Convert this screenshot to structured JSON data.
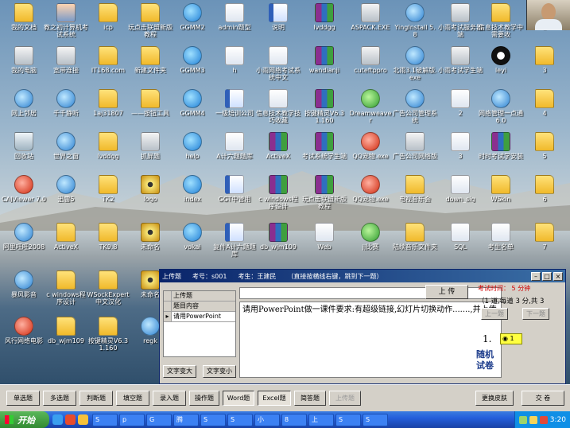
{
  "desktop": {
    "icons": [
      {
        "label": "我的文档",
        "glyph": "g-folder",
        "icon": "my-documents-icon"
      },
      {
        "label": "教之初计算机考试系统",
        "glyph": "g-person",
        "icon": "exam-system-icon"
      },
      {
        "label": "icp",
        "glyph": "g-folder",
        "icon": "folder-icon"
      },
      {
        "label": "玩点击联盟新版教程",
        "glyph": "g-folder",
        "icon": "folder-icon"
      },
      {
        "label": "GGMM2",
        "glyph": "g-ie",
        "icon": "ie-icon"
      },
      {
        "label": "admin题型",
        "glyph": "g-doc",
        "icon": "doc-icon"
      },
      {
        "label": "说明",
        "glyph": "g-word",
        "icon": "word-doc-icon"
      },
      {
        "label": "lvddgg",
        "glyph": "g-rar",
        "icon": "rar-icon"
      },
      {
        "label": "ASPACK.EXE",
        "glyph": "g-exe",
        "icon": "exe-icon"
      },
      {
        "label": "YingInstall 5.8",
        "glyph": "g-blue",
        "icon": "installer-icon"
      },
      {
        "label": "小雨考试服务器端",
        "glyph": "g-exe",
        "icon": "server-icon"
      },
      {
        "label": "信息技术教学中需要收",
        "glyph": "g-folder",
        "icon": "folder-icon"
      },
      {
        "label": "2",
        "glyph": "g-folder",
        "icon": "folder-icon"
      },
      {
        "label": "我的电脑",
        "glyph": "g-exe",
        "icon": "my-computer-icon"
      },
      {
        "label": "宽带连接",
        "glyph": "g-exe",
        "icon": "broadband-icon"
      },
      {
        "label": "IT168.com",
        "glyph": "g-folder",
        "icon": "folder-icon"
      },
      {
        "label": "新建文件夹",
        "glyph": "g-folder",
        "icon": "folder-icon"
      },
      {
        "label": "GGMM3",
        "glyph": "g-ie",
        "icon": "ie-icon"
      },
      {
        "label": "h",
        "glyph": "g-doc",
        "icon": "doc-icon"
      },
      {
        "label": "小雨网络考试系统中文",
        "glyph": "g-doc",
        "icon": "doc-icon"
      },
      {
        "label": "wandianji",
        "glyph": "g-rar",
        "icon": "rar-icon"
      },
      {
        "label": "cuteftppro",
        "glyph": "g-exe",
        "icon": "exe-icon"
      },
      {
        "label": "北雨3.1破解版.exe",
        "glyph": "g-blue",
        "icon": "exe-icon"
      },
      {
        "label": "小雨考试学生端",
        "glyph": "g-exe",
        "icon": "client-icon"
      },
      {
        "label": "leyi",
        "glyph": "g-mouse",
        "icon": "mickey-icon"
      },
      {
        "label": "3",
        "glyph": "g-folder",
        "icon": "folder-icon"
      },
      {
        "label": "网上邻居",
        "glyph": "g-blue",
        "icon": "network-icon"
      },
      {
        "label": "千千静听",
        "glyph": "g-blue",
        "icon": "music-player-icon"
      },
      {
        "label": "1aj31807",
        "glyph": "g-folder",
        "icon": "folder-icon"
      },
      {
        "label": "——按钮工具",
        "glyph": "g-folder",
        "icon": "folder-icon"
      },
      {
        "label": "GGMM4",
        "glyph": "g-ie",
        "icon": "ie-icon"
      },
      {
        "label": "一级培训公司",
        "glyph": "g-word",
        "icon": "word-doc-icon"
      },
      {
        "label": "信息技术教学技巧收藏",
        "glyph": "g-doc",
        "icon": "doc-icon"
      },
      {
        "label": "按键精灵V6.31.160",
        "glyph": "g-rar",
        "icon": "rar-icon"
      },
      {
        "label": "Dreamweaver",
        "glyph": "g-green",
        "icon": "dreamweaver-icon"
      },
      {
        "label": "广告公司管理系统",
        "glyph": "g-blue",
        "icon": "app-icon"
      },
      {
        "label": "2",
        "glyph": "g-doc",
        "icon": "doc-icon"
      },
      {
        "label": "网络管理一点通6.0",
        "glyph": "g-blue",
        "icon": "app-icon"
      },
      {
        "label": "4",
        "glyph": "g-folder",
        "icon": "folder-icon"
      },
      {
        "label": "回收站",
        "glyph": "g-trash",
        "icon": "recycle-bin-icon"
      },
      {
        "label": "世界之窗",
        "glyph": "g-blue",
        "icon": "browser-icon"
      },
      {
        "label": "lvddgg",
        "glyph": "g-folder",
        "icon": "folder-icon"
      },
      {
        "label": "抓屏题",
        "glyph": "g-exe",
        "icon": "app-icon"
      },
      {
        "label": "help",
        "glyph": "g-ie",
        "icon": "ie-icon"
      },
      {
        "label": "A计六题题库",
        "glyph": "g-doc",
        "icon": "doc-icon"
      },
      {
        "label": "ActiveX",
        "glyph": "g-rar",
        "icon": "rar-icon"
      },
      {
        "label": "考试系统学生端",
        "glyph": "g-rar",
        "icon": "rar-icon"
      },
      {
        "label": "QQ宠物.exe",
        "glyph": "g-red",
        "icon": "qq-pet-icon"
      },
      {
        "label": "广告公司网络版",
        "glyph": "g-exe",
        "icon": "app-icon"
      },
      {
        "label": "3",
        "glyph": "g-doc",
        "icon": "doc-icon"
      },
      {
        "label": "时时考试学安装",
        "glyph": "g-rar",
        "icon": "rar-icon"
      },
      {
        "label": "5",
        "glyph": "g-folder",
        "icon": "folder-icon"
      },
      {
        "label": "CAJViewer 7.0",
        "glyph": "g-red",
        "icon": "cajviewer-icon"
      },
      {
        "label": "迅雷5",
        "glyph": "g-blue",
        "icon": "thunder-icon"
      },
      {
        "label": "TK2",
        "glyph": "g-folder",
        "icon": "folder-icon"
      },
      {
        "label": "logo",
        "glyph": "g-eye",
        "icon": "eye-icon"
      },
      {
        "label": "index",
        "glyph": "g-ie",
        "icon": "ie-icon"
      },
      {
        "label": "GGT中管用",
        "glyph": "g-word",
        "icon": "word-doc-icon"
      },
      {
        "label": "c windows程序设计",
        "glyph": "g-rar",
        "icon": "rar-icon"
      },
      {
        "label": "玩点击联盟新版教程",
        "glyph": "g-rar",
        "icon": "rar-icon"
      },
      {
        "label": "QQ宠物.exe",
        "glyph": "g-red",
        "icon": "qq-pet-icon"
      },
      {
        "label": "电视音乐会",
        "glyph": "g-folder",
        "icon": "folder-icon"
      },
      {
        "label": "down_sig",
        "glyph": "g-doc",
        "icon": "doc-icon"
      },
      {
        "label": "WSkin",
        "glyph": "g-folder",
        "icon": "folder-icon"
      },
      {
        "label": "6",
        "glyph": "g-folder",
        "icon": "folder-icon"
      },
      {
        "label": "阿里旺旺2008",
        "glyph": "g-blue",
        "icon": "aliwangwang-icon"
      },
      {
        "label": "ActiveX",
        "glyph": "g-folder",
        "icon": "folder-icon"
      },
      {
        "label": "TK9.8",
        "glyph": "g-folder",
        "icon": "folder-icon"
      },
      {
        "label": "未命名",
        "glyph": "g-eye",
        "icon": "eye-icon"
      },
      {
        "label": "vokai",
        "glyph": "g-ie",
        "icon": "ie-icon"
      },
      {
        "label": "复件A计六题题库",
        "glyph": "g-word",
        "icon": "word-doc-icon"
      },
      {
        "label": "db_wjm109",
        "glyph": "g-rar",
        "icon": "rar-icon"
      },
      {
        "label": "Web",
        "glyph": "g-doc",
        "icon": "doc-icon"
      },
      {
        "label": "jj比赛",
        "glyph": "g-green",
        "icon": "app-icon"
      },
      {
        "label": "陆续音乐文件夹",
        "glyph": "g-folder",
        "icon": "folder-icon"
      },
      {
        "label": "SQL",
        "glyph": "g-doc",
        "icon": "doc-icon"
      },
      {
        "label": "考生名单",
        "glyph": "g-doc",
        "icon": "doc-icon"
      },
      {
        "label": "7",
        "glyph": "g-folder",
        "icon": "folder-icon"
      },
      {
        "label": "暴风影音",
        "glyph": "g-blue",
        "icon": "media-player-icon"
      },
      {
        "label": "c windows程序设计",
        "glyph": "g-folder",
        "icon": "folder-icon"
      },
      {
        "label": "WSockExpert中文汉化",
        "glyph": "g-folder",
        "icon": "folder-icon"
      },
      {
        "label": "未命名",
        "glyph": "g-eye",
        "icon": "eye-icon"
      },
      {
        "label": "风行网络电影",
        "glyph": "g-red",
        "icon": "funshion-icon"
      },
      {
        "label": "db_wjm109",
        "glyph": "g-folder",
        "icon": "folder-icon"
      },
      {
        "label": "按键精灵V6.31.160",
        "glyph": "g-folder",
        "icon": "folder-icon"
      },
      {
        "label": "regk",
        "glyph": "g-blue",
        "icon": "app-icon"
      }
    ]
  },
  "exam_window": {
    "title_app": "上传题",
    "title_id": "考号：s001",
    "title_student": "考生：王建民",
    "title_hint": "（直接按横线右键，跳到下一题）",
    "grid_header": "上传题",
    "grid_col": "题目内容",
    "grid_row_num": "1",
    "grid_row_text": "请用PowerPoint",
    "question": "请用PowerPoint做一课件要求:有超级链接,幻灯片切换动作.......,并上传",
    "upload_label": "上 传",
    "font_bigger": "文字变大",
    "font_smaller": "文字变小",
    "time_label": "考试时间：",
    "time_value": "5",
    "time_unit": "分钟",
    "info": "（1 道,每道 3 分,共 3",
    "prev_label": "上一题",
    "next_label": "下一题",
    "answer_num": "1.",
    "radio_label": "1",
    "logo": "随机试卷"
  },
  "question_buttons": [
    {
      "label": "单选题",
      "state": "normal"
    },
    {
      "label": "多选题",
      "state": "normal"
    },
    {
      "label": "判断题",
      "state": "normal"
    },
    {
      "label": "填空题",
      "state": "normal"
    },
    {
      "label": "录入题",
      "state": "normal"
    },
    {
      "label": "操作题",
      "state": "normal"
    },
    {
      "label": "Word题",
      "state": "active"
    },
    {
      "label": "Excel题",
      "state": "active"
    },
    {
      "label": "简答题",
      "state": "normal"
    },
    {
      "label": "上传题",
      "state": "disabled"
    }
  ],
  "change_skin_label": "更换皮肤",
  "submit_label": "交 卷",
  "taskbar": {
    "start_label": "开始",
    "tasks": [
      "S",
      "p",
      "G",
      "腾",
      "S",
      "S",
      "小",
      "8",
      "上",
      "S",
      "S"
    ],
    "clock": "3:20"
  }
}
